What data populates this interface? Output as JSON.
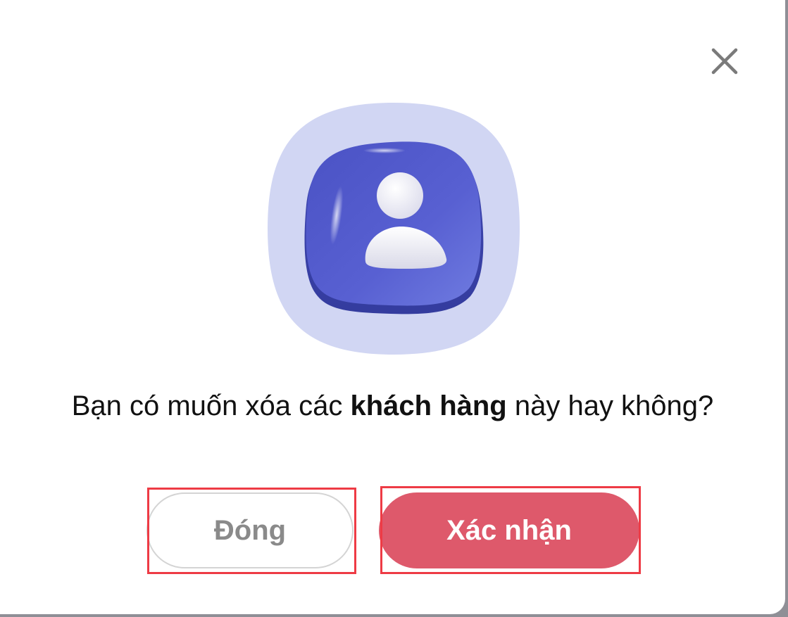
{
  "dialog": {
    "close_icon": "close-icon",
    "illustration_icon": "user-profile-icon",
    "message": {
      "prefix": "Bạn có muốn xóa các ",
      "bold": "khách hàng",
      "suffix": " này hay không?"
    },
    "buttons": {
      "close_label": "Đóng",
      "confirm_label": "Xác nhận"
    }
  },
  "colors": {
    "confirm": "#de596b",
    "icon_bg_light": "#d1d6f3",
    "icon_tile": "#4f58c9",
    "highlight": "#ee3b45"
  }
}
